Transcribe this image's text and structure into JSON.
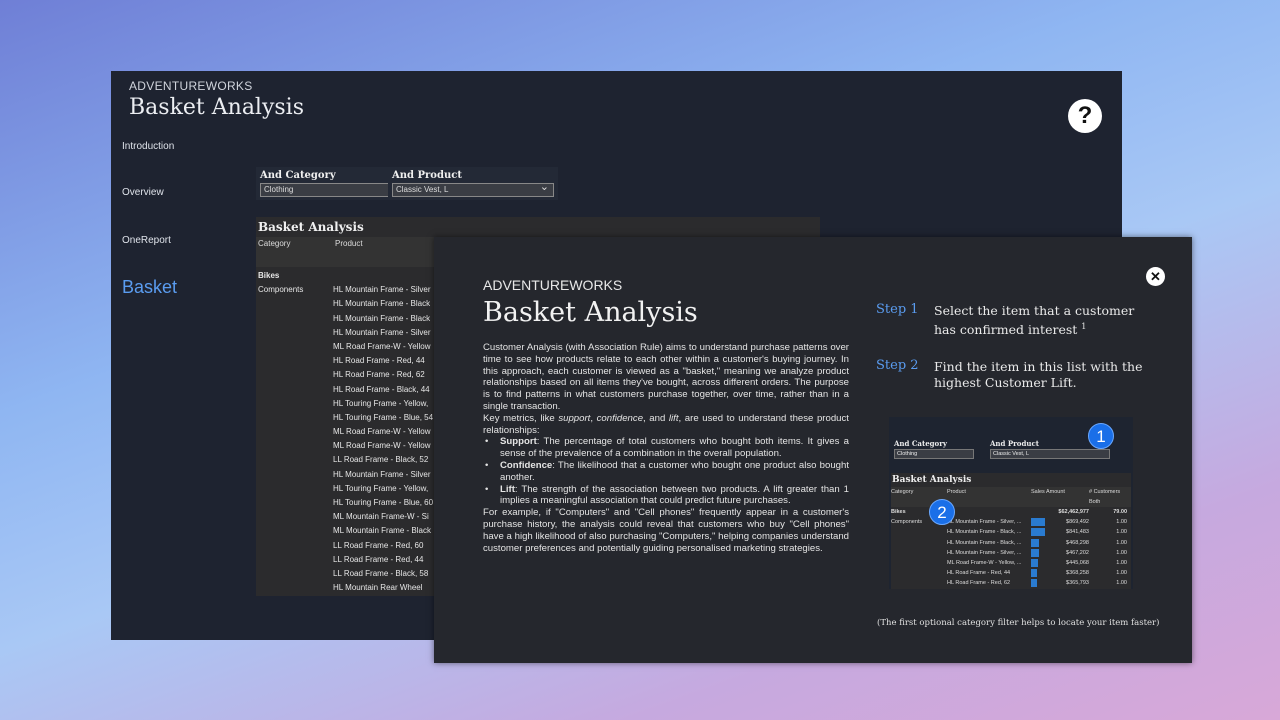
{
  "app": {
    "brand": "ADVENTUREWORKS",
    "title": "Basket Analysis",
    "help_icon": "question-icon"
  },
  "nav": [
    {
      "label": "Introduction"
    },
    {
      "label": "Overview"
    },
    {
      "label": "OneReport"
    },
    {
      "label": "Basket",
      "active": true
    }
  ],
  "slicers": {
    "category": {
      "label": "And Category",
      "value": "Clothing"
    },
    "product": {
      "label": "And Product",
      "value": "Classic Vest, L"
    }
  },
  "table": {
    "title": "Basket Analysis",
    "columns": [
      "Category",
      "Product"
    ],
    "categories": [
      "Bikes",
      "Components"
    ],
    "products": [
      "HL Mountain Frame - Silver",
      "HL Mountain Frame - Black",
      "HL Mountain Frame - Black",
      "HL Mountain Frame - Silver",
      "ML Road Frame-W - Yellow",
      "HL Road Frame - Red, 44",
      "HL Road Frame - Red, 62",
      "HL Road Frame - Black, 44",
      "HL Touring Frame - Yellow,",
      "HL Touring Frame - Blue, 54",
      "ML Road Frame-W - Yellow",
      "ML Road Frame-W - Yellow",
      "LL Road Frame - Black, 52",
      "HL Mountain Frame - Silver",
      "HL Touring Frame - Yellow,",
      "HL Touring Frame - Blue, 60",
      "ML Mountain Frame-W - Si",
      "ML Mountain Frame - Black",
      "LL Road Frame - Red, 60",
      "LL Road Frame - Red, 44",
      "LL Road Frame - Black, 58",
      "HL Mountain Rear Wheel"
    ]
  },
  "modal": {
    "brand": "ADVENTUREWORKS",
    "title": "Basket Analysis",
    "close_icon": "close-icon",
    "intro": "Customer Analysis (with Association Rule) aims to understand purchase patterns over time to see how products relate to each other within a customer's buying journey. In this approach, each customer is viewed as a \"basket,\" meaning we analyze product relationships based on all items they've bought, across different orders. The purpose is to find patterns in what customers purchase together, over time, rather than in a single transaction.",
    "metrics_pre": "Key metrics, like ",
    "m1": "support",
    "sep1": ", ",
    "m2": "confidence",
    "sep2": ", and ",
    "m3": "lift",
    "metrics_post": ", are used to understand these product relationships:",
    "bullets": [
      {
        "term": "Support",
        "text": ": The percentage of total customers who bought both items. It gives a sense of the prevalence of a combination in the overall population."
      },
      {
        "term": "Confidence",
        "text": ": The likelihood that a customer who bought one product also bought another."
      },
      {
        "term": "Lift",
        "text": ": The strength of the association between two products. A lift greater than 1 implies a meaningful association that could predict future purchases."
      }
    ],
    "example": "For example, if \"Computers\" and \"Cell phones\" frequently appear in a customer's purchase history, the analysis could reveal that customers who buy \"Cell phones\" have a high likelihood of also purchasing \"Computers,\" helping companies understand customer preferences and potentially guiding personalised marketing strategies.",
    "steps": [
      {
        "label": "Step 1",
        "text": "Select the item that a customer has confirmed interest",
        "sup": "1"
      },
      {
        "label": "Step 2",
        "text": "Find the item in this list with the highest Customer Lift."
      }
    ],
    "footnote": "(The first optional category filter helps to locate your item faster)",
    "preview": {
      "cat_label": "And Category",
      "cat_value": "Clothing",
      "prod_label": "And Product",
      "prod_value": "Classic Vest, L",
      "title": "Basket Analysis",
      "columns": [
        "Category",
        "Product",
        "Sales Amount",
        "# Customers Both"
      ],
      "bikes": {
        "category": "Bikes",
        "sales": "$62,462,977",
        "customers": "79.00"
      },
      "components_label": "Components",
      "rows": [
        {
          "product": "HL Mountain Frame - Silver, ...",
          "sales": "$869,492",
          "customers": "1.00",
          "bar": 1.0
        },
        {
          "product": "HL Mountain Frame - Black, ...",
          "sales": "$841,483",
          "customers": "1.00",
          "bar": 0.97
        },
        {
          "product": "HL Mountain Frame - Black, ...",
          "sales": "$468,298",
          "customers": "1.00",
          "bar": 0.54
        },
        {
          "product": "HL Mountain Frame - Silver, ...",
          "sales": "$467,202",
          "customers": "1.00",
          "bar": 0.54
        },
        {
          "product": "ML Road Frame-W - Yellow, ...",
          "sales": "$445,068",
          "customers": "1.00",
          "bar": 0.51
        },
        {
          "product": "HL Road Frame - Red, 44",
          "sales": "$368,258",
          "customers": "1.00",
          "bar": 0.42
        },
        {
          "product": "HL Road Frame - Red, 62",
          "sales": "$365,793",
          "customers": "1.00",
          "bar": 0.42
        }
      ],
      "badges": [
        "1",
        "2"
      ],
      "accent": "#1a6fe8"
    }
  }
}
